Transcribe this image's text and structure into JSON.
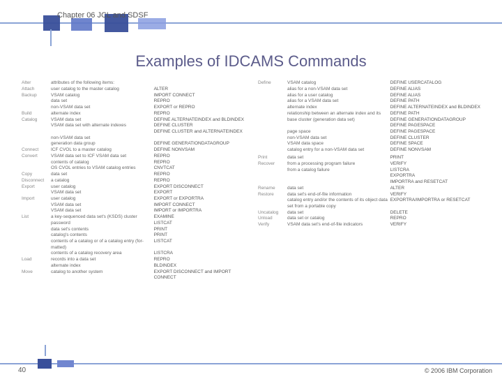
{
  "header": {
    "chapter": "Chapter 06 JCL and SDSF"
  },
  "title": "Examples of IDCAMS Commands",
  "footer": {
    "page": "40",
    "copyright": "© 2006 IBM Corporation"
  },
  "left_rows": [
    [
      "Alter",
      "attributes of the following items:",
      ""
    ],
    [
      "Attach",
      "user catalog to the master catalog",
      "ALTER"
    ],
    [
      "Backup",
      "VSAM catalog",
      "IMPORT CONNECT"
    ],
    [
      "",
      "data set",
      "REPRO"
    ],
    [
      "",
      "non-VSAM data set",
      "EXPORT or REPRO"
    ],
    [
      "Build",
      "alternate index",
      "REPRO"
    ],
    [
      "Catalog",
      "VSAM data set",
      "DEFINE ALTERNATEINDEX and BLDINDEX"
    ],
    [
      "",
      "VSAM data set with alternate indexes",
      "DEFINE CLUSTER"
    ],
    [
      "",
      "",
      "DEFINE CLUSTER and ALTERNATEINDEX"
    ],
    [
      "",
      "non-VSAM data set",
      ""
    ],
    [
      "",
      "generation data group",
      "DEFINE GENERATIONDATAGROUP"
    ],
    [
      "Connect",
      "ICF CVOL to a master catalog",
      "DEFINE NONVSAM"
    ],
    [
      "Convert",
      "VSAM data set to ICF VSAM data set",
      "REPRO"
    ],
    [
      "",
      "contents of catalog",
      "REPRO"
    ],
    [
      "",
      "OS CVOL entries to VSAM catalog entries",
      "CNVTCAT"
    ],
    [
      "Copy",
      "data set",
      "REPRO"
    ],
    [
      "Disconnect",
      "a catalog",
      "REPRO"
    ],
    [
      "Export",
      "user catalog",
      "EXPORT DISCONNECT"
    ],
    [
      "",
      "VSAM data set",
      "EXPORT"
    ],
    [
      "Import",
      "user catalog",
      "EXPORT or EXPORTRA"
    ],
    [
      "",
      "VSAM data set",
      "IMPORT CONNECT"
    ],
    [
      "",
      "VSAM data set",
      "IMPORT or IMPORTRA"
    ],
    [
      "List",
      "a key-sequenced data set's (KSDS) cluster",
      "EXAMINE"
    ],
    [
      "",
      "password",
      "LISTCAT"
    ],
    [
      "",
      "data set's contents",
      "PRINT"
    ],
    [
      "",
      "catalog's contents",
      "PRINT"
    ],
    [
      "",
      "contents of a catalog or of a catalog entry (for- ",
      "LISTCAT"
    ],
    [
      "",
      "matted)",
      ""
    ],
    [
      "",
      "contents of a catalog recovery area",
      "LISTCRA"
    ],
    [
      "Load",
      "records into a data set",
      "REPRO"
    ],
    [
      "",
      "alternate index",
      "BLDINDEX"
    ],
    [
      "Move",
      "catalog to another system",
      "EXPORT DISCONNECT and IMPORT"
    ],
    [
      "",
      "",
      "CONNECT"
    ]
  ],
  "right_rows": [
    [
      "Define",
      "VSAM catalog",
      "DEFINE USERCATALOG"
    ],
    [
      "",
      "alias for a non-VSAM data set",
      "DEFINE ALIAS"
    ],
    [
      "",
      "alias for a user catalog",
      "DEFINE ALIAS"
    ],
    [
      "",
      "alias for a VSAM data set",
      "DEFINE PATH"
    ],
    [
      "",
      "alternate index",
      "DEFINE ALTERNATEINDEX and BLDINDEX"
    ],
    [
      "",
      "relationship between an alternate index and its",
      "DEFINE PATH"
    ],
    [
      "",
      "base cluster (generation data set)",
      "DEFINE GENERATIONDATAGROUP"
    ],
    [
      "",
      "",
      "DEFINE PAGESPACE"
    ],
    [
      "",
      "page space",
      "DEFINE PAGESPACE"
    ],
    [
      "",
      "non-VSAM data set",
      "DEFINE CLUSTER"
    ],
    [
      "",
      "VSAM data space",
      "DEFINE SPACE"
    ],
    [
      "",
      "catalog entry for a non-VSAM data set",
      "DEFINE NONVSAM"
    ],
    [
      "",
      "",
      ""
    ],
    [
      "",
      "",
      ""
    ],
    [
      "",
      "",
      ""
    ],
    [
      "",
      "",
      ""
    ],
    [
      "Print",
      "data set",
      "PRINT"
    ],
    [
      "Recover",
      "from a processing program failure",
      "VERIFY"
    ],
    [
      "",
      "from a catalog failure",
      "LISTCRA"
    ],
    [
      "",
      "",
      "EXPORTRA"
    ],
    [
      "",
      "",
      "IMPORTRA and RESETCAT"
    ],
    [
      "Rename",
      "data set",
      "ALTER"
    ],
    [
      "Restore",
      "data set's end-of-file information",
      "VERIFY"
    ],
    [
      "",
      "catalog entry and/or the contents of its object data",
      "EXPORTRA/IMPORTRA or RESETCAT"
    ],
    [
      "",
      "set from a portable copy",
      ""
    ],
    [
      "Uncatalog",
      "data set",
      "DELETE"
    ],
    [
      "Unload",
      "data set or catalog",
      "REPRO"
    ],
    [
      "Verify",
      "VSAM data set's end-of-file indicators",
      "VERIFY"
    ]
  ]
}
